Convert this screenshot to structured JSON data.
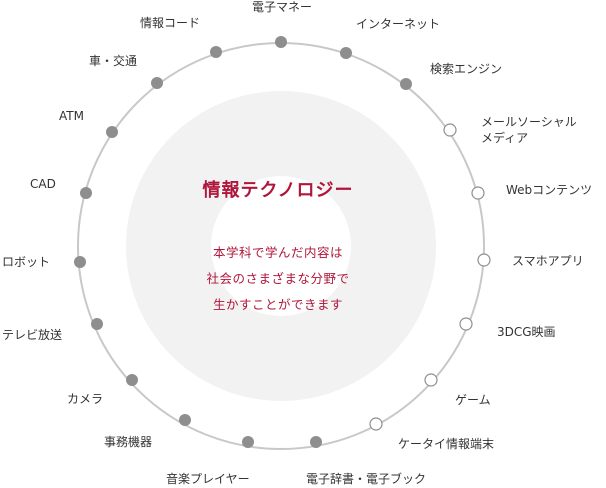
{
  "center": {
    "title": "情報テクノロジー",
    "description": [
      "本学科で学んだ内容は",
      "社会のさまざまな分野で",
      "生かすことができます"
    ]
  },
  "colors": {
    "ring": "#c8c8c8",
    "inner_fill": "#f2f2f2",
    "inner_core": "#ffffff",
    "dot_filled": "#8e8e8e",
    "dot_outline": "#8e8e8e",
    "accent": "#b0163b",
    "label": "#333333"
  },
  "fields": [
    {
      "label": "電子マネー",
      "marker": "filled"
    },
    {
      "label": "インターネット",
      "marker": "filled"
    },
    {
      "label": "検索エンジン",
      "marker": "filled"
    },
    {
      "label": "メールソーシャル\nメディア",
      "marker": "open"
    },
    {
      "label": "Webコンテンツ",
      "marker": "open"
    },
    {
      "label": "スマホアプリ",
      "marker": "open"
    },
    {
      "label": "3DCG映画",
      "marker": "open"
    },
    {
      "label": "ゲーム",
      "marker": "open"
    },
    {
      "label": "ケータイ情報端末",
      "marker": "open"
    },
    {
      "label": "電子辞書・電子ブック",
      "marker": "filled"
    },
    {
      "label": "音楽プレイヤー",
      "marker": "filled"
    },
    {
      "label": "事務機器",
      "marker": "filled"
    },
    {
      "label": "カメラ",
      "marker": "filled"
    },
    {
      "label": "テレビ放送",
      "marker": "filled"
    },
    {
      "label": "ロボット",
      "marker": "filled"
    },
    {
      "label": "CAD",
      "marker": "filled"
    },
    {
      "label": "ATM",
      "marker": "filled"
    },
    {
      "label": "車・交通",
      "marker": "filled"
    },
    {
      "label": "情報コード",
      "marker": "filled"
    }
  ]
}
